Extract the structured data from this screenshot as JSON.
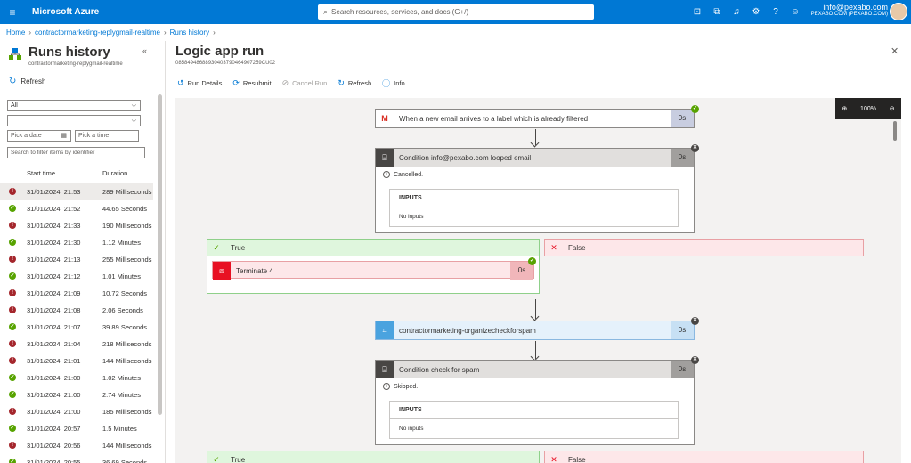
{
  "topbar": {
    "brand": "Microsoft Azure",
    "search_placeholder": "Search resources, services, and docs (G+/)",
    "user_email": "info@pexabo.com",
    "user_org": "PEXABO.COM (PEXABO.COM)",
    "accent": "#0078d4"
  },
  "breadcrumb": {
    "home": "Home",
    "app": "contractormarketing-replygmail-realtime",
    "page": "Runs history"
  },
  "left": {
    "title": "Runs history",
    "subtitle": "contractormarketing-replygmail-realtime",
    "refresh": "Refresh",
    "status_filter": "All",
    "second_filter": "",
    "date_placeholder": "Pick a date",
    "time_placeholder": "Pick a time",
    "identifier_placeholder": "Search to filter items by identifier",
    "col_start": "Start time",
    "col_duration": "Duration",
    "runs": [
      {
        "status": "fail",
        "start": "31/01/2024, 21:53",
        "duration": "289 Milliseconds"
      },
      {
        "status": "ok",
        "start": "31/01/2024, 21:52",
        "duration": "44.65 Seconds"
      },
      {
        "status": "fail",
        "start": "31/01/2024, 21:33",
        "duration": "190 Milliseconds"
      },
      {
        "status": "ok",
        "start": "31/01/2024, 21:30",
        "duration": "1.12 Minutes"
      },
      {
        "status": "fail",
        "start": "31/01/2024, 21:13",
        "duration": "255 Milliseconds"
      },
      {
        "status": "ok",
        "start": "31/01/2024, 21:12",
        "duration": "1.01 Minutes"
      },
      {
        "status": "fail",
        "start": "31/01/2024, 21:09",
        "duration": "10.72 Seconds"
      },
      {
        "status": "fail",
        "start": "31/01/2024, 21:08",
        "duration": "2.06 Seconds"
      },
      {
        "status": "ok",
        "start": "31/01/2024, 21:07",
        "duration": "39.89 Seconds"
      },
      {
        "status": "fail",
        "start": "31/01/2024, 21:04",
        "duration": "218 Milliseconds"
      },
      {
        "status": "fail",
        "start": "31/01/2024, 21:01",
        "duration": "144 Milliseconds"
      },
      {
        "status": "ok",
        "start": "31/01/2024, 21:00",
        "duration": "1.02 Minutes"
      },
      {
        "status": "ok",
        "start": "31/01/2024, 21:00",
        "duration": "2.74 Minutes"
      },
      {
        "status": "fail",
        "start": "31/01/2024, 21:00",
        "duration": "185 Milliseconds"
      },
      {
        "status": "ok",
        "start": "31/01/2024, 20:57",
        "duration": "1.5 Minutes"
      },
      {
        "status": "fail",
        "start": "31/01/2024, 20:56",
        "duration": "144 Milliseconds"
      },
      {
        "status": "ok",
        "start": "31/01/2024, 20:55",
        "duration": "36.69 Seconds"
      }
    ]
  },
  "run": {
    "title": "Logic app run",
    "more": "···",
    "id": "08584948688930403790464907259CU02",
    "toolbar": {
      "details": "Run Details",
      "resubmit": "Resubmit",
      "cancel": "Cancel Run",
      "refresh": "Refresh",
      "info": "Info"
    },
    "zoom": "100%",
    "steps": {
      "trigger": {
        "label": "When a new email arrives to a label which is already filtered",
        "duration": "0s"
      },
      "cond1": {
        "label": "Condition info@pexabo.com looped email",
        "duration": "0s",
        "status": "Cancelled.",
        "inputs_header": "INPUTS",
        "inputs_value": "No inputs"
      },
      "true1": "True",
      "false1": "False",
      "terminate": {
        "label": "Terminate 4",
        "duration": "0s"
      },
      "organize": {
        "label": "contractormarketing-organizecheckforspam",
        "duration": "0s"
      },
      "cond2": {
        "label": "Condition check for spam",
        "duration": "0s",
        "status": "Skipped.",
        "inputs_header": "INPUTS",
        "inputs_value": "No inputs"
      },
      "true2": "True",
      "false2": "False"
    }
  },
  "colors": {
    "fail": "#a4262c",
    "success": "#57a300",
    "true_bg": "#dff6dd",
    "false_bg": "#fde7e9"
  }
}
